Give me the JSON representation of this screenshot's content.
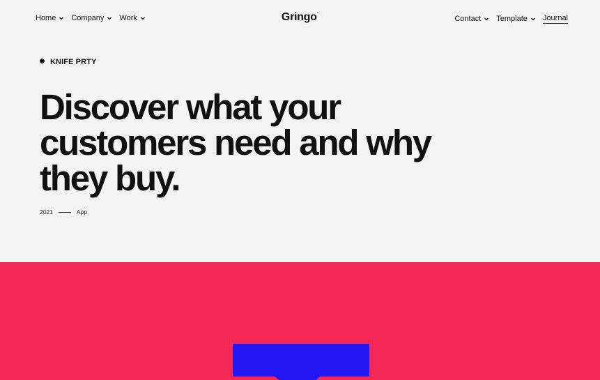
{
  "nav": {
    "left": [
      {
        "label": "Home",
        "icon": "chevron-down-icon"
      },
      {
        "label": "Company",
        "icon": "chevron-down-icon"
      },
      {
        "label": "Work",
        "icon": "chevron-down-icon"
      }
    ],
    "logo": "Gringo",
    "logo_mark": "°",
    "right": [
      {
        "label": "Contact",
        "icon": "chevron-down-icon"
      },
      {
        "label": "Template",
        "icon": "chevron-down-icon"
      },
      {
        "label": "Journal"
      }
    ]
  },
  "hero": {
    "eyebrow": "KNIFE PRTY",
    "headline": "Discover what your customers need and why they buy.",
    "year": "2021",
    "category": "App"
  },
  "colors": {
    "background": "#f3f3f3",
    "pink": "#f42856",
    "blue": "#2216f2",
    "text": "#111111"
  }
}
